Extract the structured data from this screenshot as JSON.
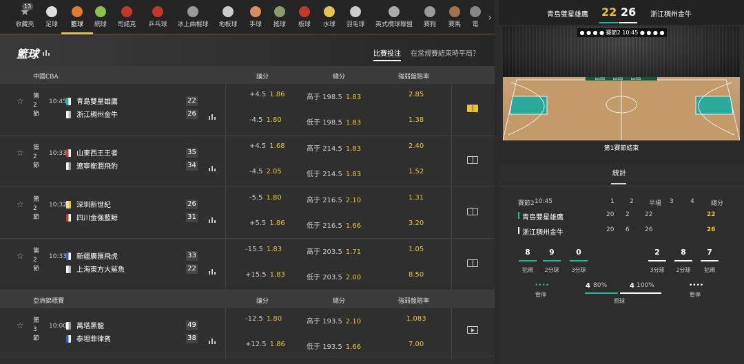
{
  "sports": [
    {
      "label": "收藏夾",
      "icon": "star-icon",
      "color": "#aaa"
    },
    {
      "label": "足球",
      "icon": "soccer-ball-icon",
      "color": "#ddd"
    },
    {
      "label": "籃球",
      "icon": "basketball-icon",
      "color": "#e07a2e"
    },
    {
      "label": "網球",
      "icon": "tennis-ball-icon",
      "color": "#8bc34a"
    },
    {
      "label": "司諾克",
      "icon": "snooker-icon",
      "color": "#c0392b"
    },
    {
      "label": "乒乓球",
      "icon": "table-tennis-icon",
      "color": "#c0392b"
    },
    {
      "label": "冰上曲棍球",
      "icon": "ice-hockey-icon",
      "color": "#999"
    },
    {
      "label": "地板球",
      "icon": "floorball-icon",
      "color": "#ccc"
    },
    {
      "label": "手球",
      "icon": "handball-icon",
      "color": "#d98c5f"
    },
    {
      "label": "搖球",
      "icon": "hurling-icon",
      "color": "#8d9a6a"
    },
    {
      "label": "板球",
      "icon": "cricket-icon",
      "color": "#c0392b"
    },
    {
      "label": "水球",
      "icon": "water-polo-icon",
      "color": "#e6c34c"
    },
    {
      "label": "羽毛球",
      "icon": "badminton-icon",
      "color": "#ccc"
    },
    {
      "label": "英式欖球聯盟",
      "icon": "rugby-icon",
      "color": "#aaa"
    },
    {
      "label": "賽狗",
      "icon": "greyhound-icon",
      "color": "#999"
    },
    {
      "label": "賽馬",
      "icon": "horse-racing-icon",
      "color": "#a0724c"
    },
    {
      "label": "電",
      "icon": "esports-icon",
      "color": "#888"
    }
  ],
  "favorites_count": "13",
  "page": {
    "title": "籃球",
    "tab_bet": "比賽投注",
    "tab_q": "在常規賽結束時平局？"
  },
  "columns": {
    "spread": "讓分",
    "total": "總分",
    "ml": "強弱盤賠率"
  },
  "competitions": [
    {
      "name": "中國CBA",
      "matches": [
        {
          "period": "第2節",
          "time": "10:45",
          "home": "青島雙星雄鷹",
          "away": "浙江稠州金牛",
          "hs": "22",
          "as": "26",
          "hc1": "#26b7a8",
          "hc2": "#fff",
          "ac1": "#fff",
          "ac2": "#bbb",
          "sp1": "+4.5",
          "so1": "1.86",
          "sp2": "-4.5",
          "so2": "1.80",
          "t1": "高于",
          "tv1": "198.5",
          "to1": "1.83",
          "t2": "低于",
          "tv2": "198.5",
          "to2": "1.83",
          "m1": "2.85",
          "m2": "1.38",
          "live": true
        },
        {
          "period": "第2節",
          "time": "10:33",
          "home": "山東西王王者",
          "away": "遼寧衡潤飛豹",
          "hs": "35",
          "as": "34",
          "hc1": "#c0392b",
          "hc2": "#fff",
          "ac1": "#fff",
          "ac2": "#999",
          "sp1": "+4.5",
          "so1": "1.68",
          "sp2": "-4.5",
          "so2": "2.05",
          "t1": "高于",
          "tv1": "214.5",
          "to1": "1.83",
          "t2": "低于",
          "tv2": "214.5",
          "to2": "1.83",
          "m1": "2.40",
          "m2": "1.52",
          "live": false
        },
        {
          "period": "第2節",
          "time": "10:32",
          "home": "深圳新世紀",
          "away": "四川金強藍鯨",
          "hs": "26",
          "as": "31",
          "hc1": "#f3e3b0",
          "hc2": "#e8c33a",
          "ac1": "#c0392b",
          "ac2": "#fff",
          "sp1": "-5.5",
          "so1": "1.80",
          "sp2": "+5.5",
          "so2": "1.86",
          "t1": "高于",
          "tv1": "216.5",
          "to1": "2.10",
          "t2": "低于",
          "tv2": "216.5",
          "to2": "1.66",
          "m1": "1.31",
          "m2": "3.20",
          "live": false
        },
        {
          "period": "第2節",
          "time": "10:33",
          "home": "新疆廣匯飛虎",
          "away": "上海東方大鯊魚",
          "hs": "33",
          "as": "22",
          "hc1": "#2962c9",
          "hc2": "#fff",
          "ac1": "#fff",
          "ac2": "#bbb",
          "sp1": "-15.5",
          "so1": "1.83",
          "sp2": "+15.5",
          "so2": "1.83",
          "t1": "高于",
          "tv1": "203.5",
          "to1": "1.71",
          "t2": "低于",
          "tv2": "203.5",
          "to2": "2.00",
          "m1": "1.05",
          "m2": "8.50",
          "live": false
        }
      ]
    },
    {
      "name": "亞洲錦標賽",
      "matches": [
        {
          "period": "第3節",
          "time": "10:00",
          "home": "萬塔黑龍",
          "away": "泰坦菲律賓",
          "hs": "49",
          "as": "38",
          "hc1": "#fff",
          "hc2": "#999",
          "ac1": "#2962c9",
          "ac2": "#fff",
          "sp1": "-12.5",
          "so1": "1.80",
          "sp2": "+12.5",
          "so2": "1.86",
          "t1": "高于",
          "tv1": "193.5",
          "to1": "2.10",
          "t2": "低于",
          "tv2": "193.5",
          "to2": "1.66",
          "m1": "1.083",
          "m2": "7.00",
          "live": false
        }
      ]
    }
  ],
  "scoreboard": {
    "home": "青島雙星雄鷹",
    "away": "浙江稠州金牛",
    "hs": "22",
    "as": "26",
    "period_pill": "賽節2",
    "pill_time": "10:45",
    "sponsor": "bet365",
    "status": "第1賽節結束"
  },
  "stats": {
    "tab": "統計",
    "period": "賽節2",
    "time": "10:45",
    "cols": [
      "1",
      "2",
      "半場",
      "3",
      "4",
      "總分"
    ],
    "rows": [
      {
        "team": "青島雙星雄鷹",
        "vals": [
          "20",
          "2",
          "22",
          "",
          "",
          "22"
        ],
        "color": "#26b7a8"
      },
      {
        "team": "浙江稠州金牛",
        "vals": [
          "20",
          "6",
          "26",
          "",
          "",
          "26"
        ],
        "color": "#ffffff"
      }
    ],
    "home": {
      "fouls": "8",
      "two": "9",
      "three": "0"
    },
    "away": {
      "three": "2",
      "two": "8",
      "fouls": "7"
    },
    "labels": {
      "fouls": "犯規",
      "two": "2分球",
      "three": "3分球",
      "timeout": "暫停",
      "ft": "罰球"
    },
    "ft_home": "4",
    "ft_home_pct": "80%",
    "ft_away": "4",
    "ft_away_pct": "100%",
    "ft_home_frac": 0.8,
    "ft_away_frac": 1.0,
    "accent": "#26b7a8"
  }
}
